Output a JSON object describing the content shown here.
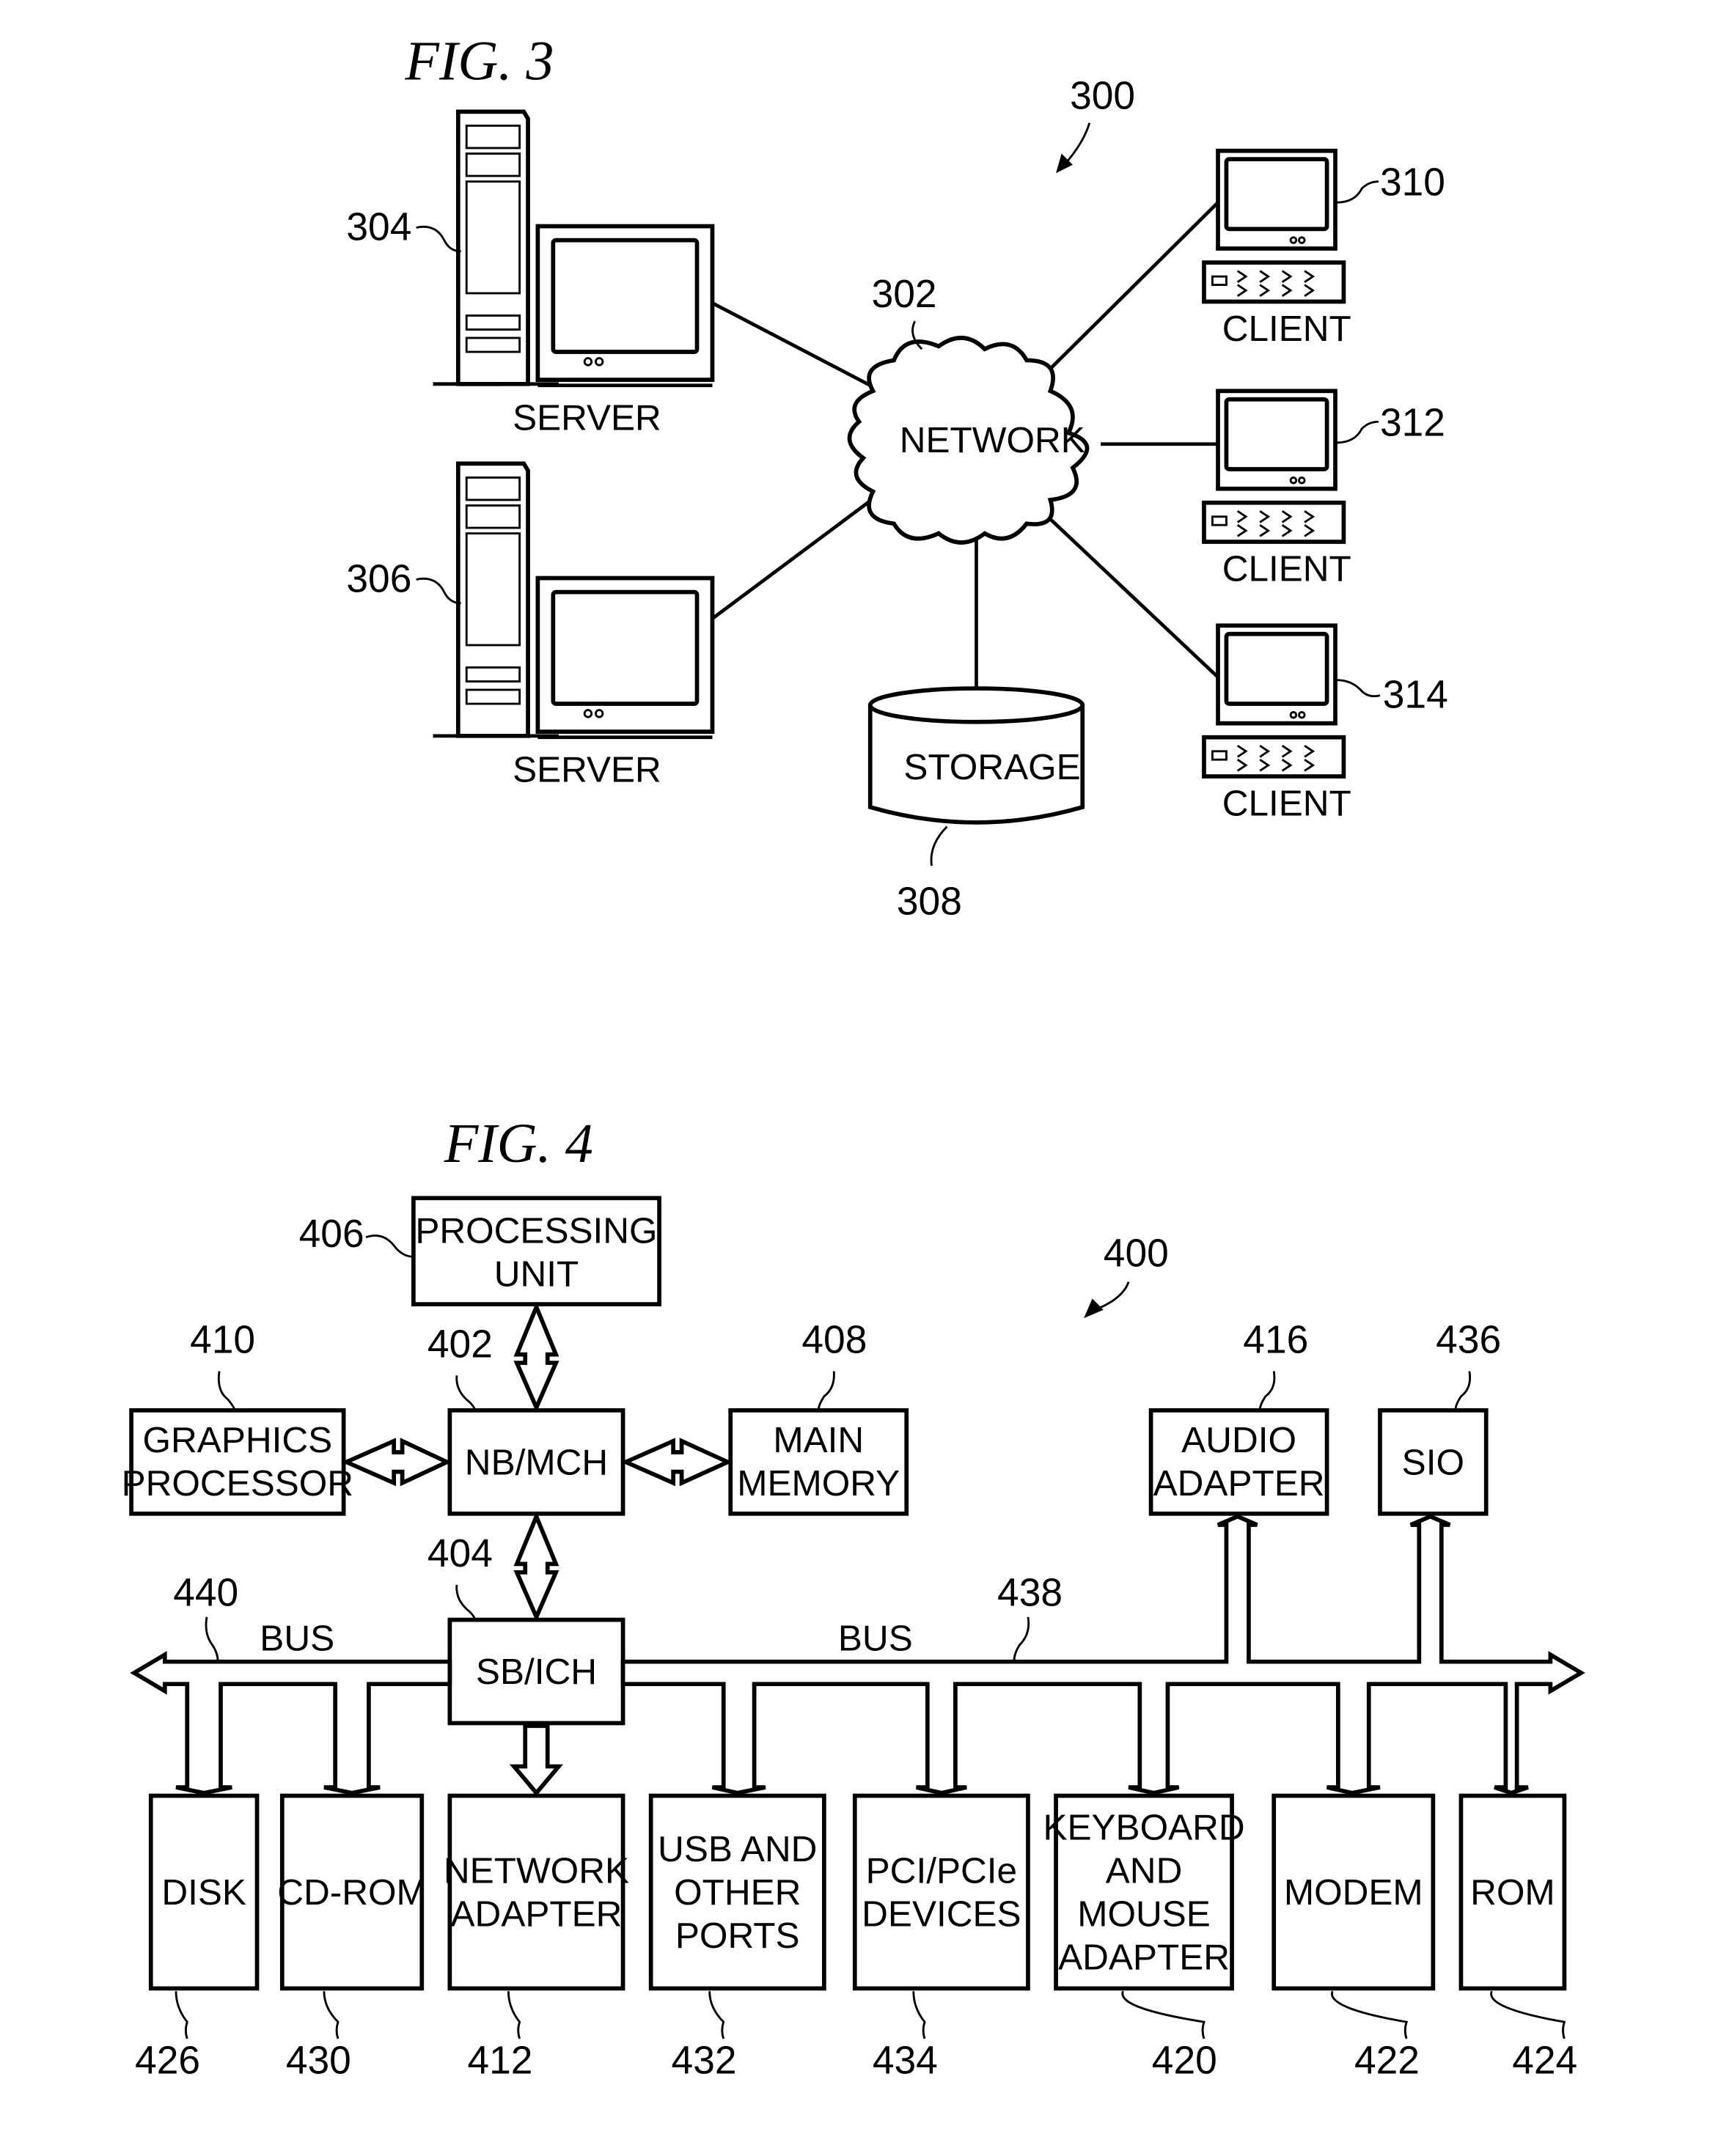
{
  "fig3": {
    "title": "FIG. 3",
    "ref_system": "300",
    "network": {
      "label": "NETWORK",
      "ref": "302"
    },
    "servers": [
      {
        "label": "SERVER",
        "ref": "304"
      },
      {
        "label": "SERVER",
        "ref": "306"
      }
    ],
    "storage": {
      "label": "STORAGE",
      "ref": "308"
    },
    "clients": [
      {
        "label": "CLIENT",
        "ref": "310"
      },
      {
        "label": "CLIENT",
        "ref": "312"
      },
      {
        "label": "CLIENT",
        "ref": "314"
      }
    ]
  },
  "fig4": {
    "title": "FIG. 4",
    "ref_system": "400",
    "processing_unit": {
      "line1": "PROCESSING",
      "line2": "UNIT",
      "ref": "406"
    },
    "nb_mch": {
      "label": "NB/MCH",
      "ref": "402"
    },
    "graphics": {
      "line1": "GRAPHICS",
      "line2": "PROCESSOR",
      "ref": "410"
    },
    "main_memory": {
      "line1": "MAIN",
      "line2": "MEMORY",
      "ref": "408"
    },
    "sb_ich": {
      "label": "SB/ICH",
      "ref": "404"
    },
    "audio": {
      "line1": "AUDIO",
      "line2": "ADAPTER",
      "ref": "416"
    },
    "sio": {
      "label": "SIO",
      "ref": "436"
    },
    "bus_left": {
      "label": "BUS",
      "ref": "440"
    },
    "bus_right": {
      "label": "BUS",
      "ref": "438"
    },
    "devices": [
      {
        "lines": [
          "DISK"
        ],
        "ref": "426"
      },
      {
        "lines": [
          "CD-ROM"
        ],
        "ref": "430"
      },
      {
        "lines": [
          "NETWORK",
          "ADAPTER"
        ],
        "ref": "412"
      },
      {
        "lines": [
          "USB AND",
          "OTHER",
          "PORTS"
        ],
        "ref": "432"
      },
      {
        "lines": [
          "PCI/PCIe",
          "DEVICES"
        ],
        "ref": "434"
      },
      {
        "lines": [
          "KEYBOARD",
          "AND",
          "MOUSE",
          "ADAPTER"
        ],
        "ref": "420"
      },
      {
        "lines": [
          "MODEM"
        ],
        "ref": "422"
      },
      {
        "lines": [
          "ROM"
        ],
        "ref": "424"
      }
    ]
  }
}
